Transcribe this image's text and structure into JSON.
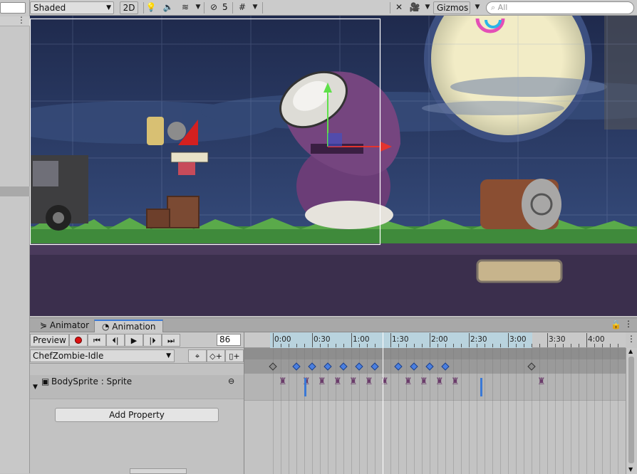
{
  "toolbar": {
    "shading_mode": "Shaded",
    "mode_2d": "2D",
    "layers_count": "5",
    "gizmos": "Gizmos",
    "search_placeholder": "All"
  },
  "animation_window": {
    "tabs": [
      {
        "label": "Animator"
      },
      {
        "label": "Animation"
      }
    ],
    "preview_label": "Preview",
    "current_frame": "86",
    "clip_name": "ChefZombie-Idle",
    "property_name": "BodySprite : Sprite",
    "add_property_label": "Add Property",
    "time_labels": [
      "0:00",
      "0:30",
      "1:00",
      "1:30",
      "2:00",
      "2:30",
      "3:00",
      "3:30",
      "4:00"
    ],
    "summary_keyframes": [
      0.0,
      0.3,
      0.5,
      0.7,
      0.9,
      1.1,
      1.3,
      1.6,
      1.8,
      2.0,
      2.2,
      3.3
    ],
    "summary_keyframes_selected": [
      0.3,
      0.5,
      0.7,
      0.9,
      1.1,
      1.3,
      1.6,
      1.8,
      2.0,
      2.2
    ],
    "accent_color": "#3a79d6",
    "keyframe_color": "#4a7fe0"
  }
}
